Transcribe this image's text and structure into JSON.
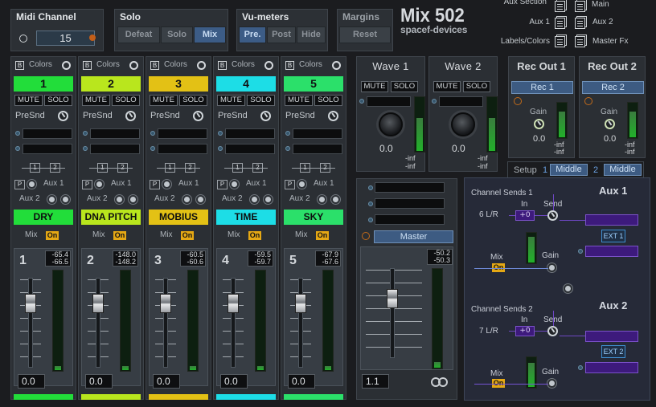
{
  "midi": {
    "title": "Midi Channel",
    "value": "15"
  },
  "solo": {
    "title": "Solo",
    "buttons": [
      "Defeat",
      "Solo",
      "Mix"
    ],
    "active": "Mix"
  },
  "vu": {
    "title": "Vu-meters",
    "buttons": [
      "Pre.",
      "Post",
      "Hide"
    ],
    "active": "Pre."
  },
  "margins": {
    "title": "Margins",
    "reset": "Reset"
  },
  "brand": {
    "name": "Mix 502",
    "maker": "spacef-devices"
  },
  "links": [
    {
      "label": "Aux Section",
      "target": "Main"
    },
    {
      "label": "Aux 1",
      "target": "Aux 2"
    },
    {
      "label": "Labels/Colors",
      "target": "Master Fx"
    }
  ],
  "strip_common": {
    "colors": "Colors",
    "b": "B",
    "mute": "MUTE",
    "solo": "SOLO",
    "presnd": "PreSnd",
    "aux1": "Aux 1",
    "aux2": "Aux 2",
    "mix": "Mix",
    "on": "On",
    "link1": "1",
    "link2": "2",
    "p": "P"
  },
  "channels": [
    {
      "num": "1",
      "name": "DRY",
      "color": "#22dd3a",
      "db_l": "-65.4",
      "db_r": "-66.5",
      "value": "0.0",
      "level": 0.04
    },
    {
      "num": "2",
      "name": "DNA PITCH",
      "color": "#b9e61d",
      "db_l": "-148.0",
      "db_r": "-148.2",
      "value": "0.0",
      "level": 0.04
    },
    {
      "num": "3",
      "name": "MOBIUS",
      "color": "#e3c115",
      "db_l": "-60.5",
      "db_r": "-60.6",
      "value": "0.0",
      "level": 0.04
    },
    {
      "num": "4",
      "name": "TIME",
      "color": "#1ddde6",
      "db_l": "-59.5",
      "db_r": "-59.7",
      "value": "0.0",
      "level": 0.04
    },
    {
      "num": "5",
      "name": "SKY",
      "color": "#2be06a",
      "db_l": "-67.9",
      "db_r": "-67.6",
      "value": "0.0",
      "level": 0.04
    }
  ],
  "waves": [
    {
      "title": "Wave 1",
      "value": "0.0",
      "inf1": "-inf",
      "inf2": "-inf"
    },
    {
      "title": "Wave 2",
      "value": "0.0",
      "inf1": "-inf",
      "inf2": "-inf"
    }
  ],
  "recs": [
    {
      "title": "Rec Out 1",
      "btn": "Rec 1",
      "gain": "Gain",
      "value": "0.0",
      "inf1": "-inf",
      "inf2": "-inf"
    },
    {
      "title": "Rec Out 2",
      "btn": "Rec 2",
      "gain": "Gain",
      "value": "0.0",
      "inf1": "-inf",
      "inf2": "-inf"
    }
  ],
  "master": {
    "label": "Master",
    "db_l": "-50.2",
    "db_r": "-50.3",
    "value": "1.1",
    "level": 0.06
  },
  "setup": {
    "label": "Setup",
    "n1": "1",
    "v1": "Middle",
    "n2": "2",
    "v2": "Middle"
  },
  "routing": {
    "a1": {
      "title": "Aux 1",
      "sends": "Channel Sends 1",
      "src": "6 L/R",
      "in": "In",
      "in_val": "+0",
      "send": "Send",
      "ext": "EXT 1",
      "mix": "Mix",
      "on": "On",
      "gain": "Gain"
    },
    "a2": {
      "title": "Aux 2",
      "sends": "Channel Sends 2",
      "src": "7 L/R",
      "in": "In",
      "in_val": "+0",
      "send": "Send",
      "ext": "EXT 2",
      "mix": "Mix",
      "on": "On",
      "gain": "Gain"
    }
  }
}
